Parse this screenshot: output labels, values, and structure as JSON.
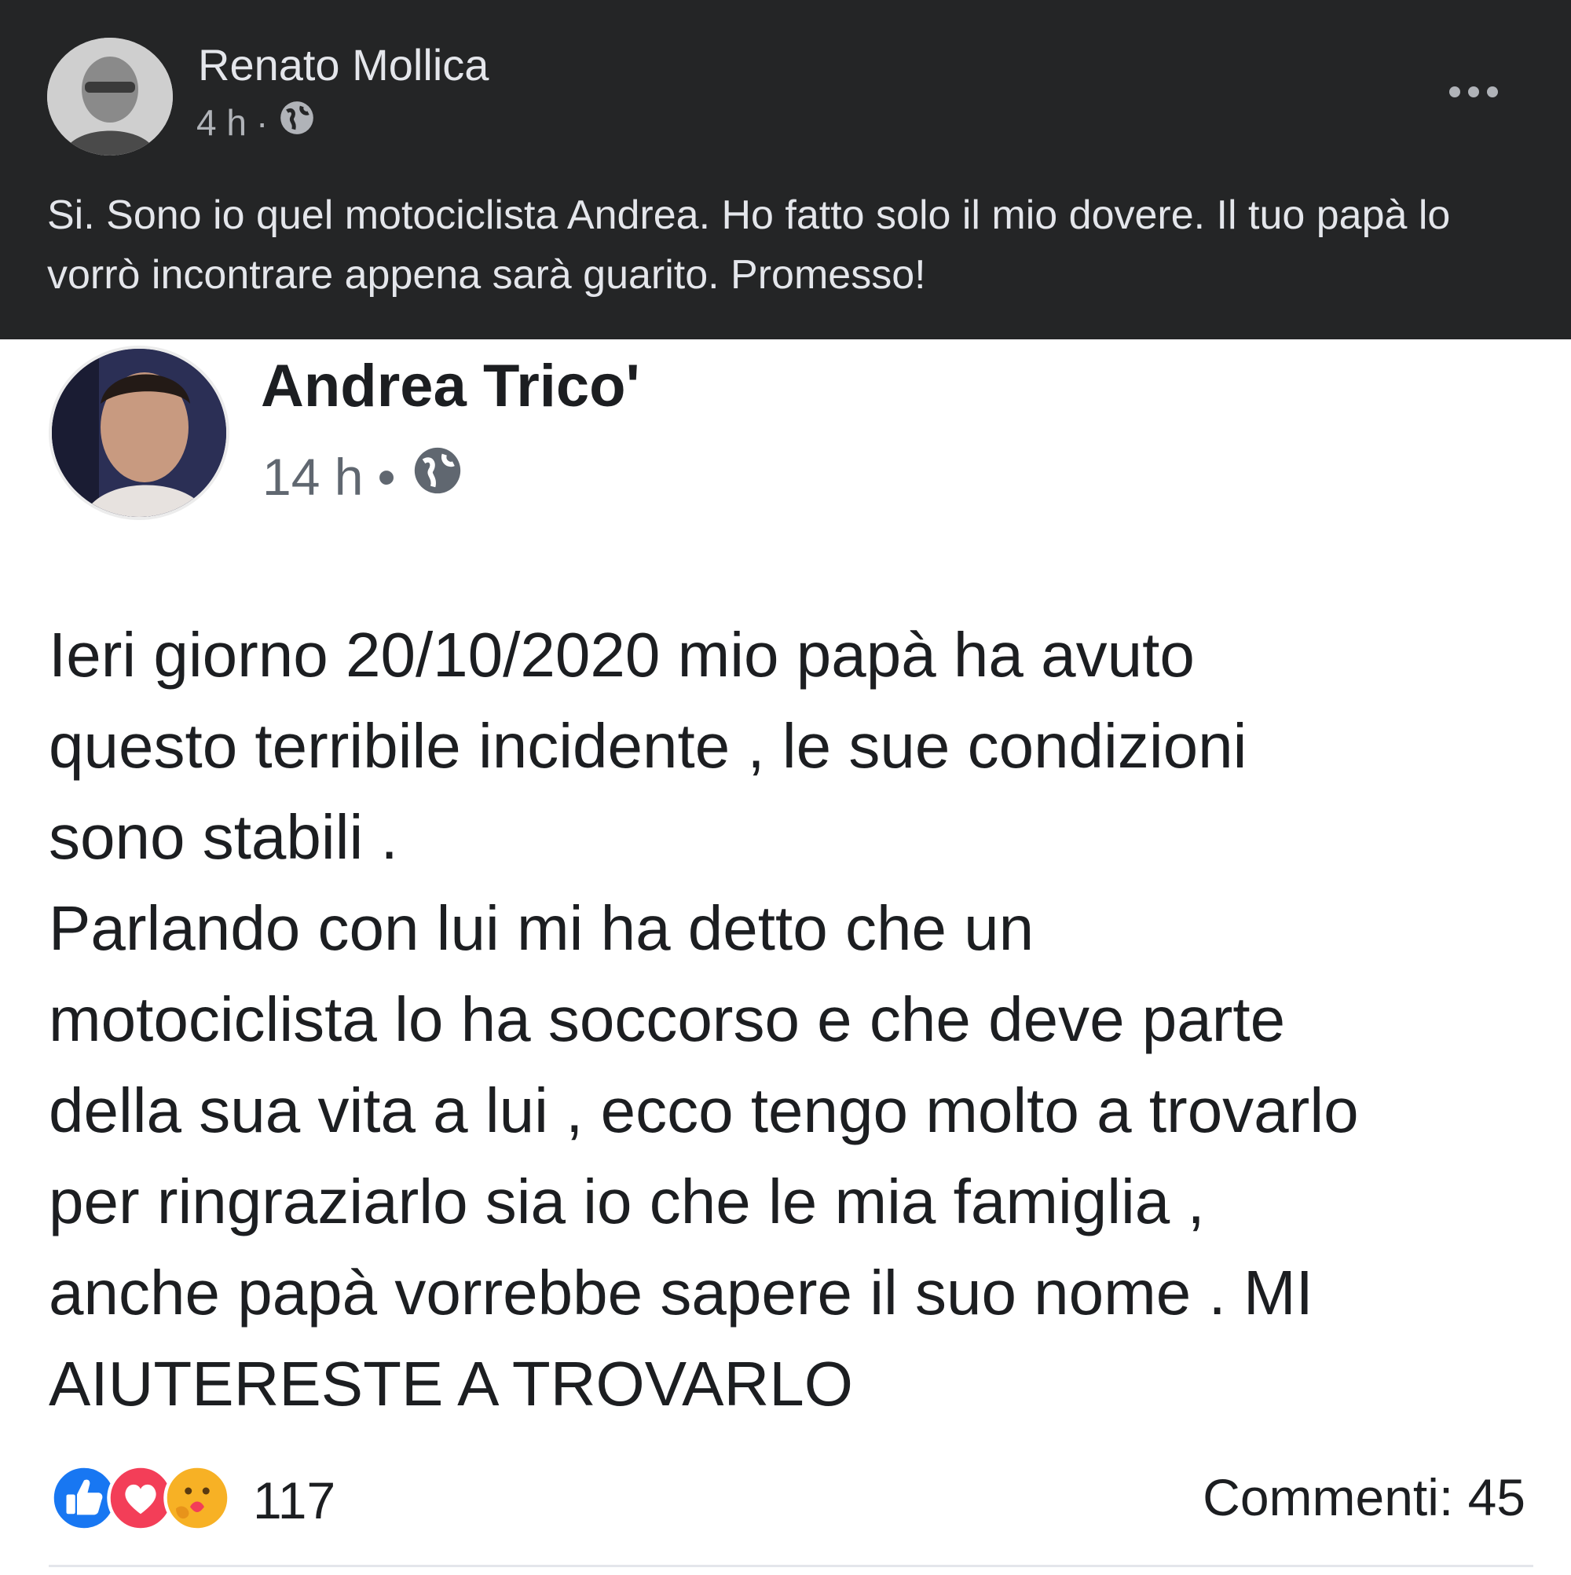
{
  "outer_post": {
    "author": "Renato Mollica",
    "time": "4 h",
    "separator": "·",
    "audience_icon": "globe-icon",
    "more_icon": "more-options-icon",
    "text": "Si. Sono io quel motociclista Andrea. Ho fatto solo il mio dovere. Il tuo papà lo vorrò incontrare appena sarà guarito. Promesso!"
  },
  "shared_post": {
    "author": "Andrea Trico'",
    "time": "14 h",
    "separator": "•",
    "audience_icon": "globe-icon",
    "text_lines": [
      "Ieri giorno 20/10/2020 mio papà ha avuto",
      "questo terribile incidente , le sue condizioni",
      "sono stabili .",
      "Parlando con lui mi ha detto che un",
      "motociclista lo ha soccorso e che deve parte",
      "della sua vita a lui , ecco tengo molto a trovarlo",
      "per ringraziarlo sia io che le mia famiglia ,",
      "anche papà vorrebbe sapere il suo nome . MI",
      "AIUTERESTE A TROVARLO"
    ],
    "reactions": {
      "icons": [
        "like-icon",
        "love-icon",
        "care-icon"
      ],
      "count": "117"
    },
    "comments_label": "Commenti: 45"
  },
  "colors": {
    "dark_background": "#242526",
    "like_blue": "#1877f2",
    "love_red": "#f33e58",
    "care_yellow": "#f7b125"
  }
}
